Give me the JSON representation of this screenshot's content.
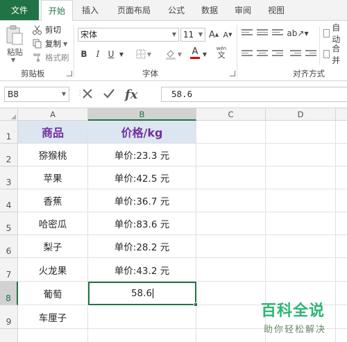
{
  "ribbon_tabs": [
    "文件",
    "开始",
    "插入",
    "页面布局",
    "公式",
    "数据",
    "审阅",
    "视图"
  ],
  "clipboard": {
    "paste": "粘贴",
    "cut": "剪切",
    "copy": "复制",
    "format_painter": "格式刷",
    "group_label": "剪贴板"
  },
  "font": {
    "name": "宋体",
    "size": "11",
    "bold": "B",
    "italic": "I",
    "underline": "U",
    "group_label": "字体",
    "wen": "wén"
  },
  "alignment": {
    "group_label": "对齐方式",
    "wrap": "自动",
    "merge": "合并"
  },
  "formula_bar": {
    "name_box": "B8",
    "formula": "58.6",
    "fx": "fx"
  },
  "columns": [
    "A",
    "B",
    "C",
    "D"
  ],
  "selected_column": "B",
  "rows": [
    {
      "num": "1",
      "a": "商品",
      "b": "价格/kg"
    },
    {
      "num": "2",
      "a": "猕猴桃",
      "b": "单价:23.3 元"
    },
    {
      "num": "3",
      "a": "苹果",
      "b": "单价:42.5 元"
    },
    {
      "num": "4",
      "a": "香蕉",
      "b": "单价:36.7 元"
    },
    {
      "num": "5",
      "a": "哈密瓜",
      "b": "单价:83.6 元"
    },
    {
      "num": "6",
      "a": "梨子",
      "b": "单价:28.2 元"
    },
    {
      "num": "7",
      "a": "火龙果",
      "b": "单价:43.2 元"
    },
    {
      "num": "8",
      "a": "葡萄",
      "b": "58.6"
    },
    {
      "num": "9",
      "a": "车厘子",
      "b": ""
    }
  ],
  "active_cell": {
    "ref": "B8",
    "value": "58.6"
  },
  "watermark": {
    "title": "百科全说",
    "subtitle": "助你轻松解决"
  },
  "colors": {
    "excel_green": "#217346",
    "header_fill": "#dce6f1",
    "header_text": "#7030a0",
    "watermark": "#2bb673"
  }
}
